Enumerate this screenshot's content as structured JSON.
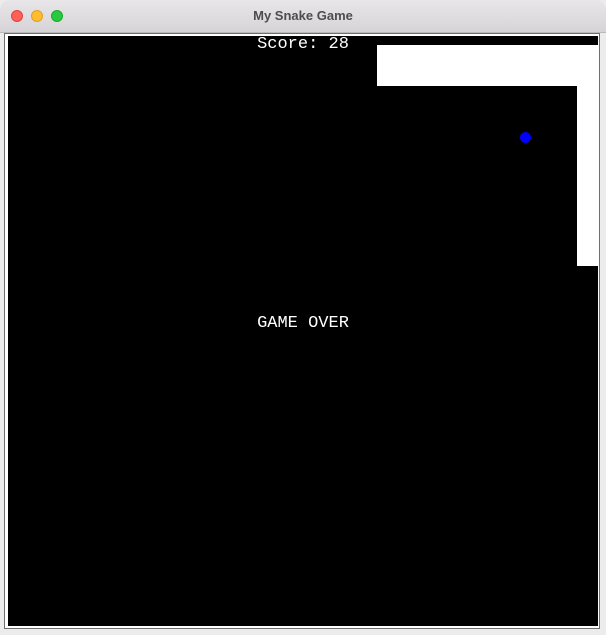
{
  "window": {
    "title": "My Snake Game"
  },
  "game": {
    "score_text": "Score: 28",
    "status_text": "GAME OVER",
    "snake_color": "#ffffff",
    "food_color": "#0000ff",
    "background_color": "#000000"
  }
}
